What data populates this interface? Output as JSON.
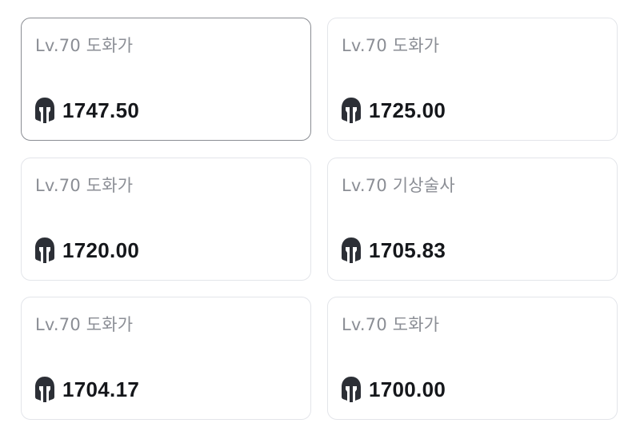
{
  "characters": [
    {
      "title": "Lv.70 도화가",
      "score": "1747.50",
      "selected": true
    },
    {
      "title": "Lv.70 도화가",
      "score": "1725.00",
      "selected": false
    },
    {
      "title": "Lv.70 도화가",
      "score": "1720.00",
      "selected": false
    },
    {
      "title": "Lv.70 기상술사",
      "score": "1705.83",
      "selected": false
    },
    {
      "title": "Lv.70 도화가",
      "score": "1704.17",
      "selected": false
    },
    {
      "title": "Lv.70 도화가",
      "score": "1700.00",
      "selected": false
    }
  ],
  "icon": "spartan-helmet-icon",
  "colors": {
    "title": "#8b8e95",
    "score": "#15171b",
    "border": "#e3e5ea",
    "selected_border": "#8a8d93",
    "helmet": "#2c2f36"
  }
}
